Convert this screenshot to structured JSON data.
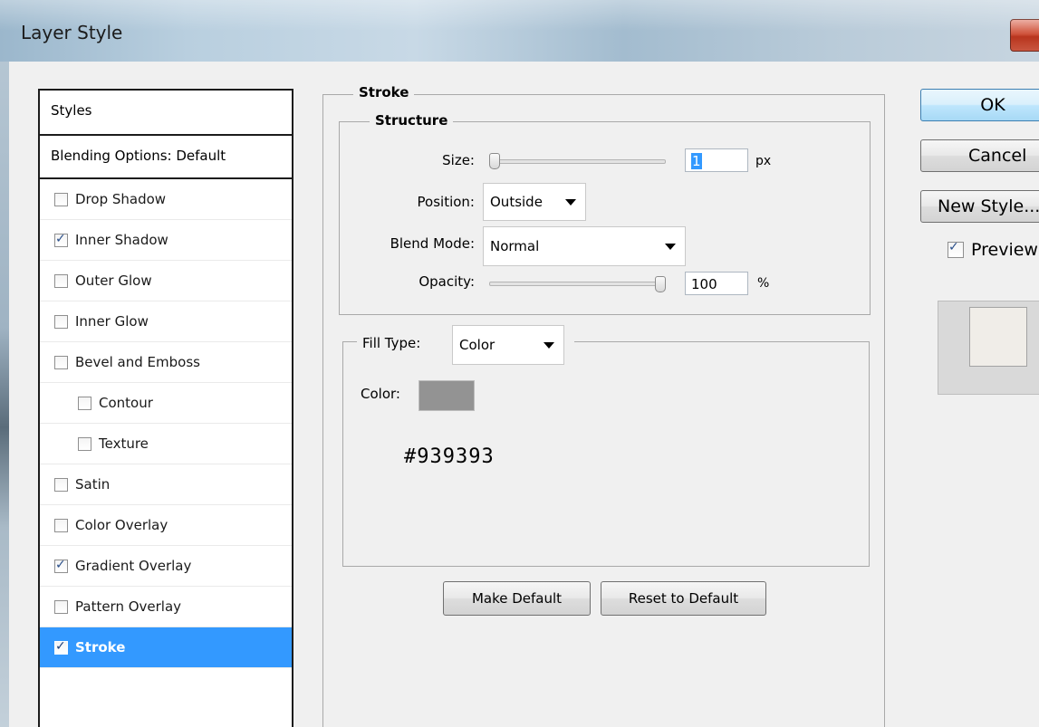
{
  "window": {
    "title": "Layer Style"
  },
  "styles_panel": {
    "header": "Styles",
    "blending": "Blending Options: Default",
    "items": [
      {
        "label": "Drop Shadow",
        "checked": false
      },
      {
        "label": "Inner Shadow",
        "checked": true
      },
      {
        "label": "Outer Glow",
        "checked": false
      },
      {
        "label": "Inner Glow",
        "checked": false
      },
      {
        "label": "Bevel and Emboss",
        "checked": false
      },
      {
        "label": "Contour",
        "checked": false
      },
      {
        "label": "Texture",
        "checked": false
      },
      {
        "label": "Satin",
        "checked": false
      },
      {
        "label": "Color Overlay",
        "checked": false
      },
      {
        "label": "Gradient Overlay",
        "checked": true
      },
      {
        "label": "Pattern Overlay",
        "checked": false
      },
      {
        "label": "Stroke",
        "checked": true,
        "selected": true
      }
    ]
  },
  "stroke": {
    "title": "Stroke",
    "structure": {
      "title": "Structure",
      "size_label": "Size:",
      "size_value": "1",
      "size_unit": "px",
      "position_label": "Position:",
      "position_value": "Outside",
      "blend_label": "Blend Mode:",
      "blend_value": "Normal",
      "opacity_label": "Opacity:",
      "opacity_value": "100",
      "opacity_unit": "%",
      "opacity_level": 1.0,
      "size_level": 0.0
    },
    "fill": {
      "type_label": "Fill Type:",
      "type_value": "Color",
      "color_label": "Color:",
      "color_hex": "#939393",
      "color_text": "#939393"
    },
    "make_default": "Make Default",
    "reset_default": "Reset to Default"
  },
  "buttons": {
    "ok": "OK",
    "cancel": "Cancel",
    "new_style": "New Style...",
    "preview_label": "Preview",
    "preview_checked": true
  }
}
